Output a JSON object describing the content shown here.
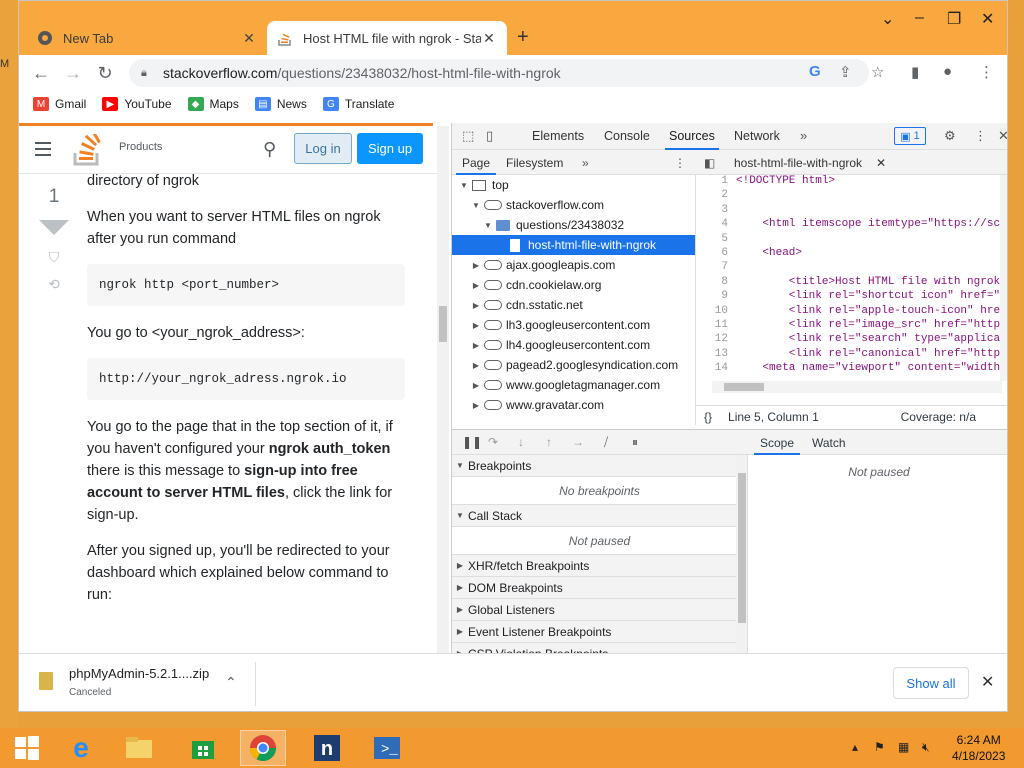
{
  "desktop": {
    "side_letter": "M"
  },
  "browser": {
    "tabs": [
      {
        "title": "New Tab",
        "active": false
      },
      {
        "title": "Host HTML file with ngrok - Stack",
        "active": true
      }
    ],
    "url": {
      "host": "stackoverflow.com",
      "path": "/questions/23438032/host-html-file-with-ngrok"
    },
    "bookmarks": [
      "Gmail",
      "YouTube",
      "Maps",
      "News",
      "Translate"
    ]
  },
  "so": {
    "products": "Products",
    "login": "Log in",
    "signup": "Sign up",
    "vote_count": "1",
    "answer": {
      "p0": "directory of ngrok",
      "p1": "When you want to server HTML files on ngrok after you run command",
      "code1": "ngrok http <port_number>",
      "p2": "You go to <your_ngrok_address>:",
      "code2": "http://your_ngrok_adress.ngrok.io",
      "p3_a": "You go to the page that in the top section of it, if you haven't configured your ",
      "p3_b": "ngrok auth_token",
      "p3_c": " there is this message to ",
      "p3_d": "sign-up into free account to server HTML files",
      "p3_e": ", click the link for sign-up.",
      "p4": "After you signed up, you'll be redirected to your dashboard which explained below command to run:"
    }
  },
  "devtools": {
    "tabs": [
      "Elements",
      "Console",
      "Sources",
      "Network"
    ],
    "active_tab": "Sources",
    "issues_count": "1",
    "nav_tabs": [
      "Page",
      "Filesystem"
    ],
    "tree": [
      {
        "label": "top",
        "indent": 0,
        "kind": "frame",
        "arrow": "▼"
      },
      {
        "label": "stackoverflow.com",
        "indent": 1,
        "kind": "cloud",
        "arrow": "▼"
      },
      {
        "label": "questions/23438032",
        "indent": 2,
        "kind": "folder",
        "arrow": "▼"
      },
      {
        "label": "host-html-file-with-ngrok",
        "indent": 3,
        "kind": "file",
        "arrow": "",
        "selected": true
      },
      {
        "label": "ajax.googleapis.com",
        "indent": 1,
        "kind": "cloud",
        "arrow": "▶"
      },
      {
        "label": "cdn.cookielaw.org",
        "indent": 1,
        "kind": "cloud",
        "arrow": "▶"
      },
      {
        "label": "cdn.sstatic.net",
        "indent": 1,
        "kind": "cloud",
        "arrow": "▶"
      },
      {
        "label": "lh3.googleusercontent.com",
        "indent": 1,
        "kind": "cloud",
        "arrow": "▶"
      },
      {
        "label": "lh4.googleusercontent.com",
        "indent": 1,
        "kind": "cloud",
        "arrow": "▶"
      },
      {
        "label": "pagead2.googlesyndication.com",
        "indent": 1,
        "kind": "cloud",
        "arrow": "▶"
      },
      {
        "label": "www.googletagmanager.com",
        "indent": 1,
        "kind": "cloud",
        "arrow": "▶"
      },
      {
        "label": "www.gravatar.com",
        "indent": 1,
        "kind": "cloud",
        "arrow": "▶"
      }
    ],
    "editor_tab": "host-html-file-with-ngrok",
    "code": [
      {
        "n": "1",
        "t": "<!DOCTYPE html>"
      },
      {
        "n": "2",
        "t": ""
      },
      {
        "n": "3",
        "t": ""
      },
      {
        "n": "4",
        "t": "    <html itemscope itemtype=\"https://sch"
      },
      {
        "n": "5",
        "t": ""
      },
      {
        "n": "6",
        "t": "    <head>"
      },
      {
        "n": "7",
        "t": ""
      },
      {
        "n": "8",
        "t": "        <title>Host HTML file with ngrok"
      },
      {
        "n": "9",
        "t": "        <link rel=\"shortcut icon\" href=\"h"
      },
      {
        "n": "10",
        "t": "        <link rel=\"apple-touch-icon\" hre"
      },
      {
        "n": "11",
        "t": "        <link rel=\"image_src\" href=\"https"
      },
      {
        "n": "12",
        "t": "        <link rel=\"search\" type=\"applicat"
      },
      {
        "n": "13",
        "t": "        <link rel=\"canonical\" href=\"https"
      },
      {
        "n": "14",
        "t": "    <meta name=\"viewport\" content=\"width="
      }
    ],
    "status": {
      "position": "Line 5, Column 1",
      "coverage": "Coverage: n/a"
    },
    "scope_tabs": [
      "Scope",
      "Watch"
    ],
    "panes": [
      {
        "title": "Breakpoints",
        "open": true,
        "body": "No breakpoints"
      },
      {
        "title": "Call Stack",
        "open": true,
        "body": "Not paused"
      },
      {
        "title": "XHR/fetch Breakpoints",
        "open": false
      },
      {
        "title": "DOM Breakpoints",
        "open": false
      },
      {
        "title": "Global Listeners",
        "open": false
      },
      {
        "title": "Event Listener Breakpoints",
        "open": false
      },
      {
        "title": "CSP Violation Breakpoints",
        "open": false
      }
    ],
    "scope_body": "Not paused"
  },
  "download": {
    "file": "phpMyAdmin-5.2.1....zip",
    "status": "Canceled",
    "show_all": "Show all"
  },
  "taskbar": {
    "time": "6:24 AM",
    "date": "4/18/2023"
  },
  "colors": {
    "so_orange": "#f48024",
    "so_blue": "#0a95ff",
    "chrome_blue": "#1a73e8",
    "desktop": "#e8a13a"
  }
}
